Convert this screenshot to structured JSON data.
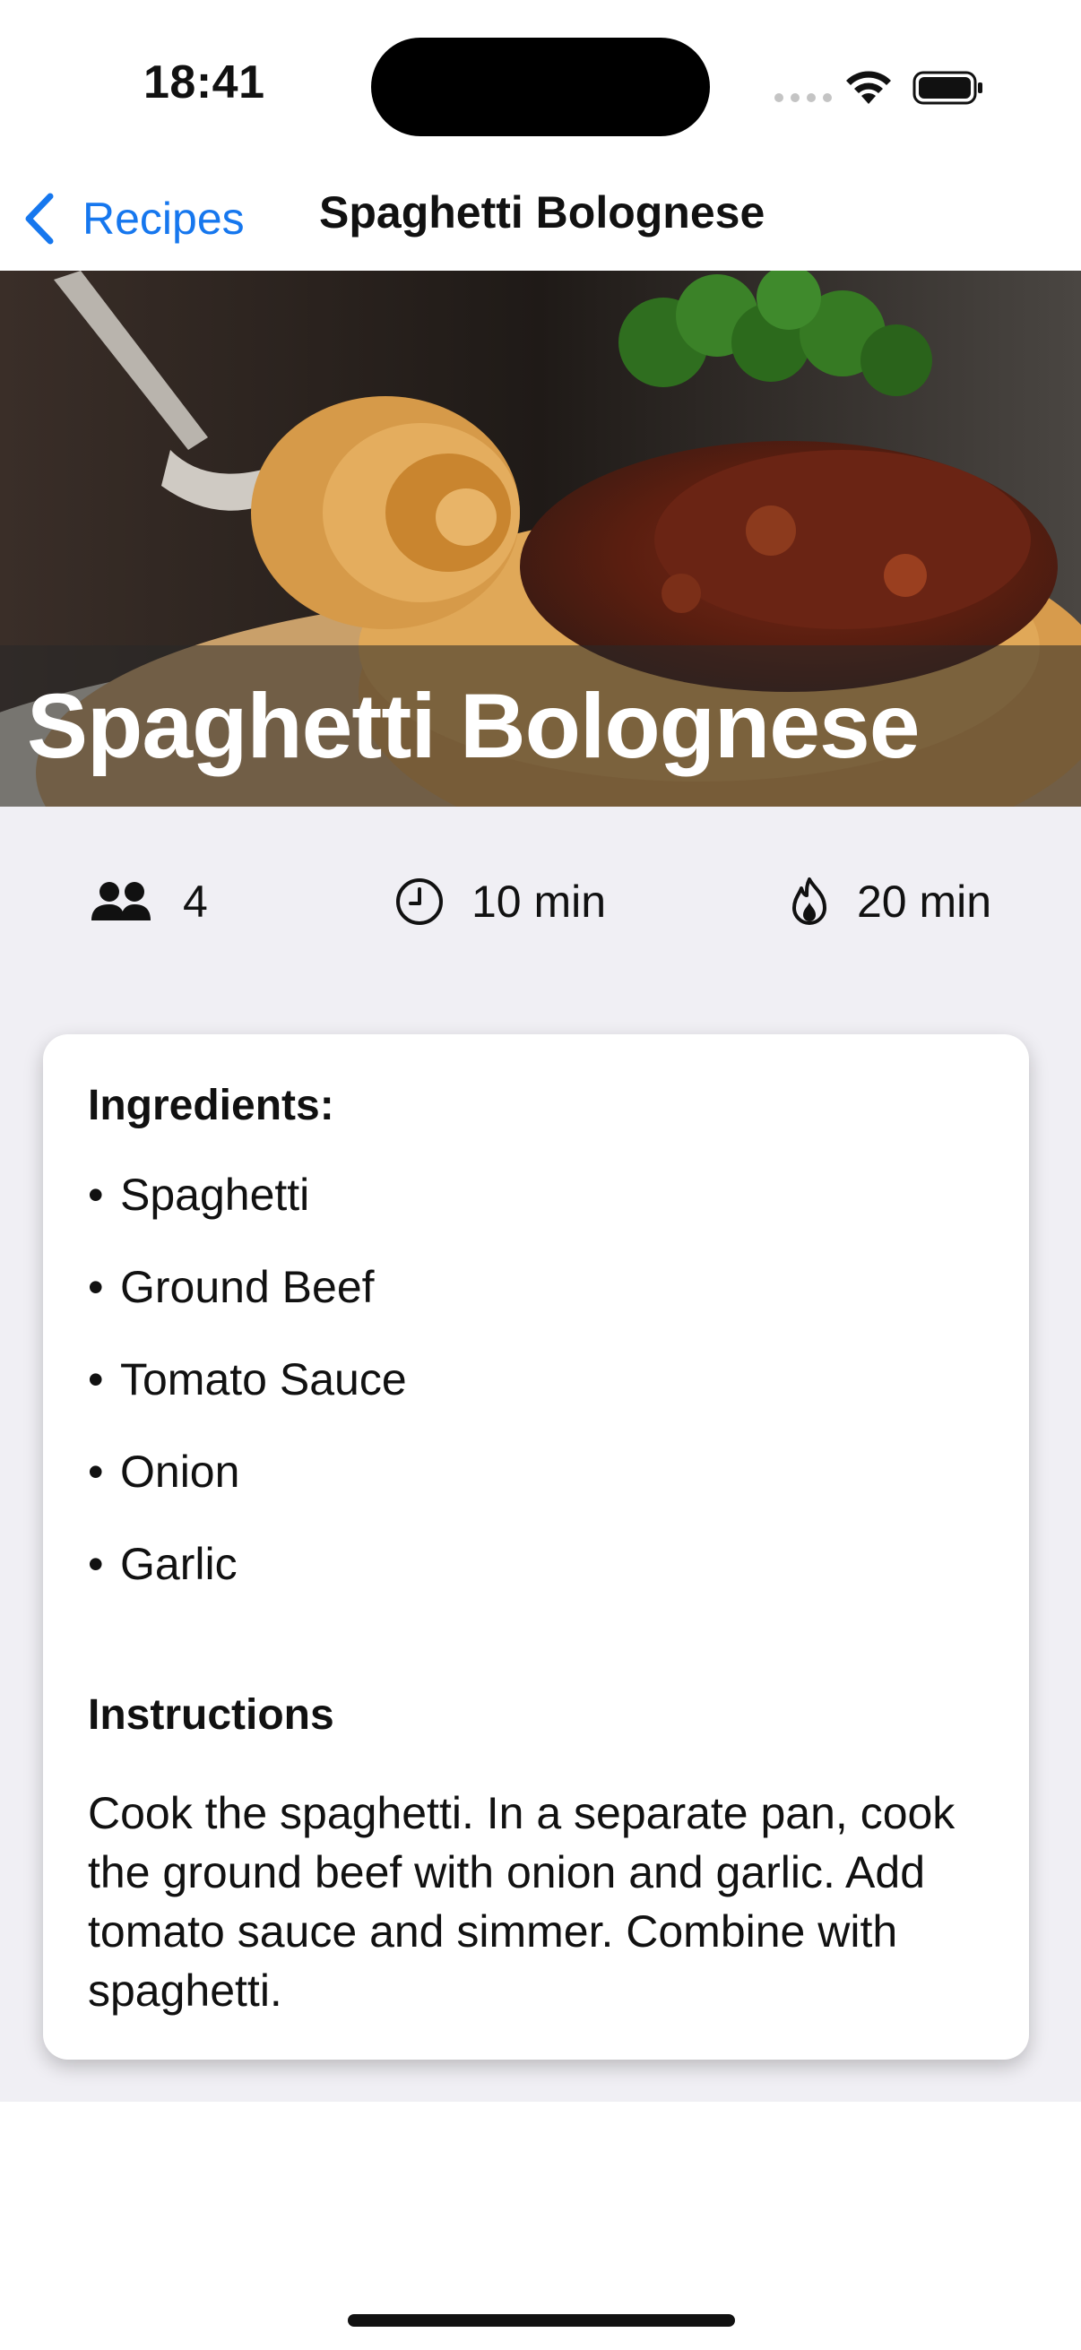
{
  "status_bar": {
    "time": "18:41"
  },
  "nav": {
    "back_label": "Recipes",
    "title": "Spaghetti Bolognese",
    "accent_color": "#1677ee"
  },
  "hero": {
    "title": "Spaghetti Bolognese",
    "image_subject": "spaghetti bolognese with fork and parsley"
  },
  "stats": {
    "servings": {
      "icon": "people-icon",
      "value": "4"
    },
    "prep_time": {
      "icon": "clock-icon",
      "value": "10 min"
    },
    "cook_time": {
      "icon": "flame-icon",
      "value": "20 min"
    }
  },
  "card": {
    "ingredients_heading": "Ingredients:",
    "bullet": "•",
    "ingredients": [
      "Spaghetti",
      "Ground Beef",
      "Tomato Sauce",
      "Onion",
      "Garlic"
    ],
    "instructions_heading": "Instructions",
    "instructions": "Cook the spaghetti. In a separate pan, cook the ground beef with onion and garlic. Add tomato sauce and simmer. Combine with spaghetti."
  }
}
